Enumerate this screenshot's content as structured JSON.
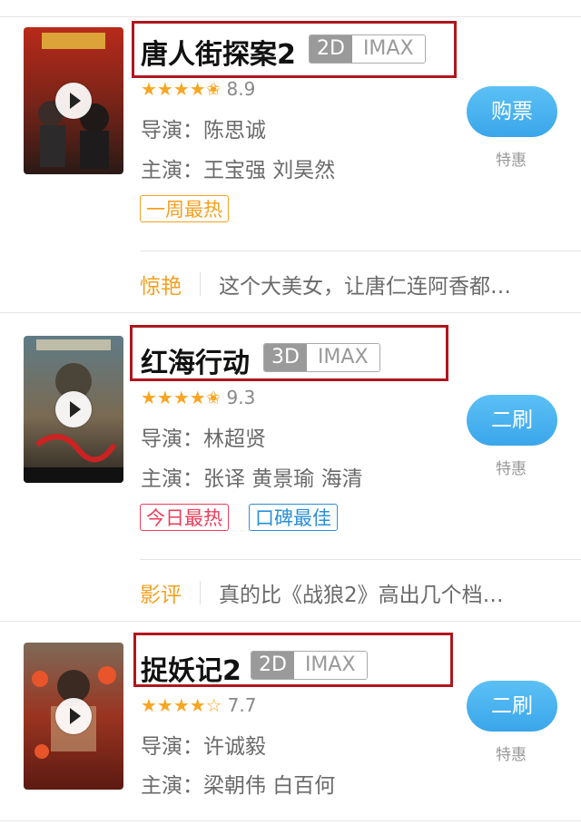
{
  "movies": [
    {
      "title": "唐人街探案2",
      "format": "2D",
      "format2": "IMAX",
      "stars": "★★★★✬",
      "score": "8.9",
      "director_label": "导演：",
      "director": "陈思诚",
      "cast_label": "主演：",
      "cast": "王宝强 刘昊然",
      "tags": [
        "一周最热"
      ],
      "button": "购票",
      "promo": "特惠",
      "review_key": "惊艳",
      "review_text": "这个大美女，让唐仁连阿香都…"
    },
    {
      "title": "红海行动",
      "format": "3D",
      "format2": "IMAX",
      "stars": "★★★★✬",
      "score": "9.3",
      "director_label": "导演：",
      "director": "林超贤",
      "cast_label": "主演：",
      "cast": "张译 黄景瑜 海清",
      "tags": [
        "今日最热",
        "口碑最佳"
      ],
      "button": "二刷",
      "promo": "特惠",
      "review_key": "影评",
      "review_text": "真的比《战狼2》高出几个档…"
    },
    {
      "title": "捉妖记2",
      "format": "2D",
      "format2": "IMAX",
      "stars": "★★★★☆",
      "score": "7.7",
      "director_label": "导演：",
      "director": "许诚毅",
      "cast_label": "主演：",
      "cast": "梁朝伟 白百何",
      "button": "二刷",
      "promo": "特惠"
    }
  ],
  "colors": {
    "accent": "#3aa6ea",
    "star": "#f6a623",
    "highlight_box": "#b0161e"
  }
}
